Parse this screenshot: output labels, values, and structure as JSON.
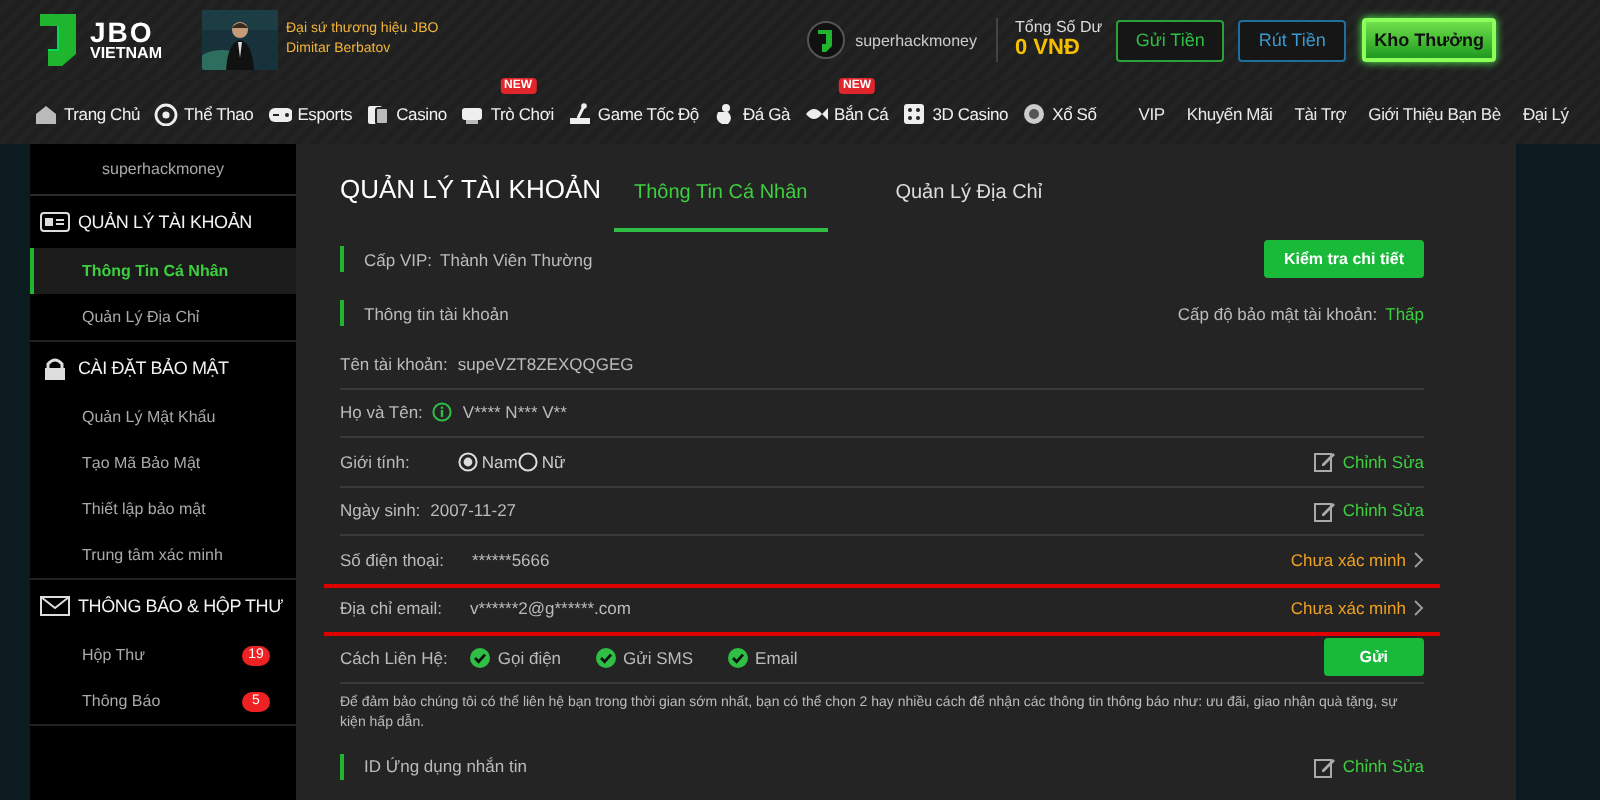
{
  "header": {
    "logo": {
      "name": "JBO",
      "region": "VIETNAM"
    },
    "ambassador": {
      "kind": "picture",
      "lines": [
        "Đại sứ thương hiệu JBO",
        "Dimitar Berbatov"
      ]
    },
    "user": {
      "name": "superhackmoney"
    },
    "balance": {
      "label": "Tổng Số Dư",
      "amount": "0 VNĐ"
    },
    "buttons": [
      {
        "kind": "deposit",
        "label": "Gửi Tiền"
      },
      {
        "kind": "withdraw",
        "label": "Rút Tiền"
      },
      {
        "kind": "reward",
        "label": "Kho Thưởng"
      }
    ]
  },
  "nav": {
    "items": [
      {
        "label": "Trang Chủ"
      },
      {
        "label": "Thể Thao"
      },
      {
        "label": "Esports"
      },
      {
        "label": "Casino"
      },
      {
        "label": "Trò Chơi",
        "badge": "NEW"
      },
      {
        "label": "Game Tốc Độ"
      },
      {
        "label": "Đá Gà"
      },
      {
        "label": "Bắn Cá",
        "badge": "NEW"
      },
      {
        "label": "3D Casino"
      },
      {
        "label": "Xổ Số"
      }
    ],
    "links": [
      "VIP",
      "Khuyến Mãi",
      "Tài Trợ",
      "Giới Thiệu Bạn Bè",
      "Đại Lý"
    ]
  },
  "sidebar": {
    "username": "superhackmoney",
    "sections": [
      {
        "title": "QUẢN LÝ TÀI KHOẢN",
        "items": [
          {
            "label": "Thông Tin Cá Nhân",
            "selected": true
          },
          {
            "label": "Quản Lý Địa Chỉ",
            "selected": false
          }
        ]
      },
      {
        "title": "CÀI ĐẶT BẢO MẬT",
        "items": [
          {
            "label": "Quản Lý Mật Khẩu",
            "selected": false
          },
          {
            "label": "Tạo Mã Bảo Mật",
            "selected": false
          },
          {
            "label": "Thiết lập bảo mật",
            "selected": false
          },
          {
            "label": "Trung tâm xác minh",
            "selected": false
          }
        ]
      },
      {
        "title": "THÔNG BÁO & HỘP THƯ",
        "items": [
          {
            "label": "Hộp Thư",
            "selected": false,
            "badge": "19"
          },
          {
            "label": "Thông Báo",
            "selected": false,
            "badge": "5"
          }
        ]
      }
    ]
  },
  "account": {
    "title": "QUẢN LÝ TÀI KHOẢN",
    "tabs": [
      {
        "label": "Thông Tin Cá Nhân",
        "selected": true
      },
      {
        "label": "Quản Lý Địa Chỉ",
        "selected": false
      }
    ],
    "vip": {
      "label": "Cấp VIP:",
      "value": "Thành Viên Thường",
      "button": "Kiểm tra chi tiết"
    },
    "info": {
      "label": "Thông tin tài khoản",
      "security_label": "Cấp độ bảo mật tài khoản:",
      "security_value": "Thấp"
    },
    "fields": [
      {
        "kind": "text",
        "label": "Tên tài khoản:",
        "value": "supeVZT8ZEXQQGEG"
      },
      {
        "kind": "verified",
        "label": "Họ và Tên:",
        "value": "V**** N*** V**"
      },
      {
        "kind": "radio",
        "label": "Giới tính:",
        "options": [
          {
            "label": "Nam",
            "selected": true
          },
          {
            "label": "Nữ",
            "selected": false
          }
        ],
        "action": "Chỉnh Sửa"
      },
      {
        "kind": "text",
        "label": "Ngày sinh:",
        "value": "2007-11-27",
        "action": "Chỉnh Sửa"
      },
      {
        "kind": "status",
        "label": "Số điện thoại:",
        "value": "******5666",
        "status": "Chưa xác minh",
        "underlined": true
      },
      {
        "kind": "status",
        "label": "Địa chỉ email:",
        "value": "v******2@g******.com",
        "status": "Chưa xác minh",
        "underlined": true
      },
      {
        "kind": "checks",
        "label": "Cách Liên Hệ:",
        "options": [
          {
            "label": "Gọi điện",
            "checked": true
          },
          {
            "label": "Gửi SMS",
            "checked": true
          },
          {
            "label": "Email",
            "checked": true
          }
        ],
        "button": "Gửi"
      }
    ],
    "note": "Để đảm bảo chúng tôi có thể liên hệ bạn trong thời gian sớm nhất, bạn có thể chọn 2 hay nhiều cách để nhận các thông tin thông báo như: ưu đãi, giao nhận quà tặng, sự kiện hấp dẫn.",
    "messaging": {
      "label": "ID Ứng dụng nhắn tin",
      "action": "Chỉnh Sửa"
    }
  }
}
